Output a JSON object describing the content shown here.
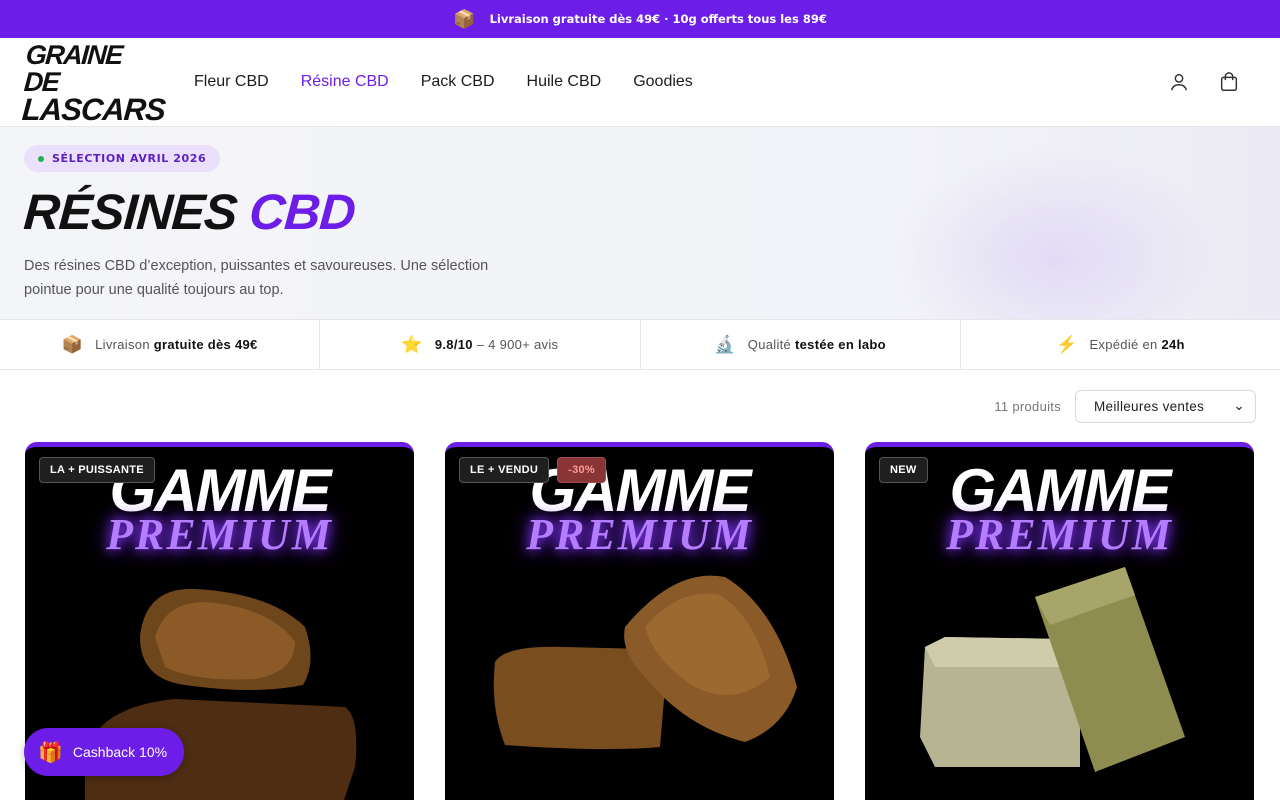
{
  "topbar": {
    "icon": "package-icon",
    "text": "Livraison gratuite dès 49€ · 10g offerts tous les 89€"
  },
  "header": {
    "logo_line1": "GRAINE DE",
    "logo_line2": "LASCARS",
    "nav": [
      {
        "label": "Fleur CBD",
        "active": false
      },
      {
        "label": "Résine CBD",
        "active": true
      },
      {
        "label": "Pack CBD",
        "active": false
      },
      {
        "label": "Huile CBD",
        "active": false
      },
      {
        "label": "Goodies",
        "active": false
      }
    ],
    "icons": [
      "user-icon",
      "cart-icon"
    ]
  },
  "hero": {
    "pill": "SÉLECTION AVRIL 2026",
    "title_main": "RÉSINES",
    "title_accent": "CBD",
    "description": "Des résines CBD d’exception, puissantes et savoureuses. Une sélection pointue pour une qualité toujours au top."
  },
  "features": [
    {
      "icon": "package-icon",
      "pre": "Livraison",
      "bold": "gratuite dès 49€",
      "post": ""
    },
    {
      "icon": "star-icon",
      "pre": "",
      "bold": "9.8/10",
      "post": "– 4 900+ avis"
    },
    {
      "icon": "microscope-icon",
      "pre": "Qualité",
      "bold": "testée en labo",
      "post": ""
    },
    {
      "icon": "lightning-icon",
      "pre": "Expédié en",
      "bold": "24h",
      "post": ""
    }
  ],
  "toolbar": {
    "count": "11 produits",
    "sort": "Meilleures ventes"
  },
  "products": [
    {
      "title1": "GAMME",
      "title2": "PREMIUM",
      "badges": [
        "LA + PUISSANTE"
      ],
      "sale": "",
      "color": "#7a4a1c"
    },
    {
      "title1": "GAMME",
      "title2": "PREMIUM",
      "badges": [
        "LE + VENDU"
      ],
      "sale": "-30%",
      "color": "#8a5a26"
    },
    {
      "title1": "GAMME",
      "title2": "PREMIUM",
      "badges": [
        "NEW"
      ],
      "sale": "",
      "color": "#9a9860"
    }
  ],
  "cashback": {
    "label": "Cashback 10%",
    "icon": "gift-icon"
  },
  "colors": {
    "accent": "#6c1ee8",
    "hero_bg": "#f3f4f8"
  }
}
